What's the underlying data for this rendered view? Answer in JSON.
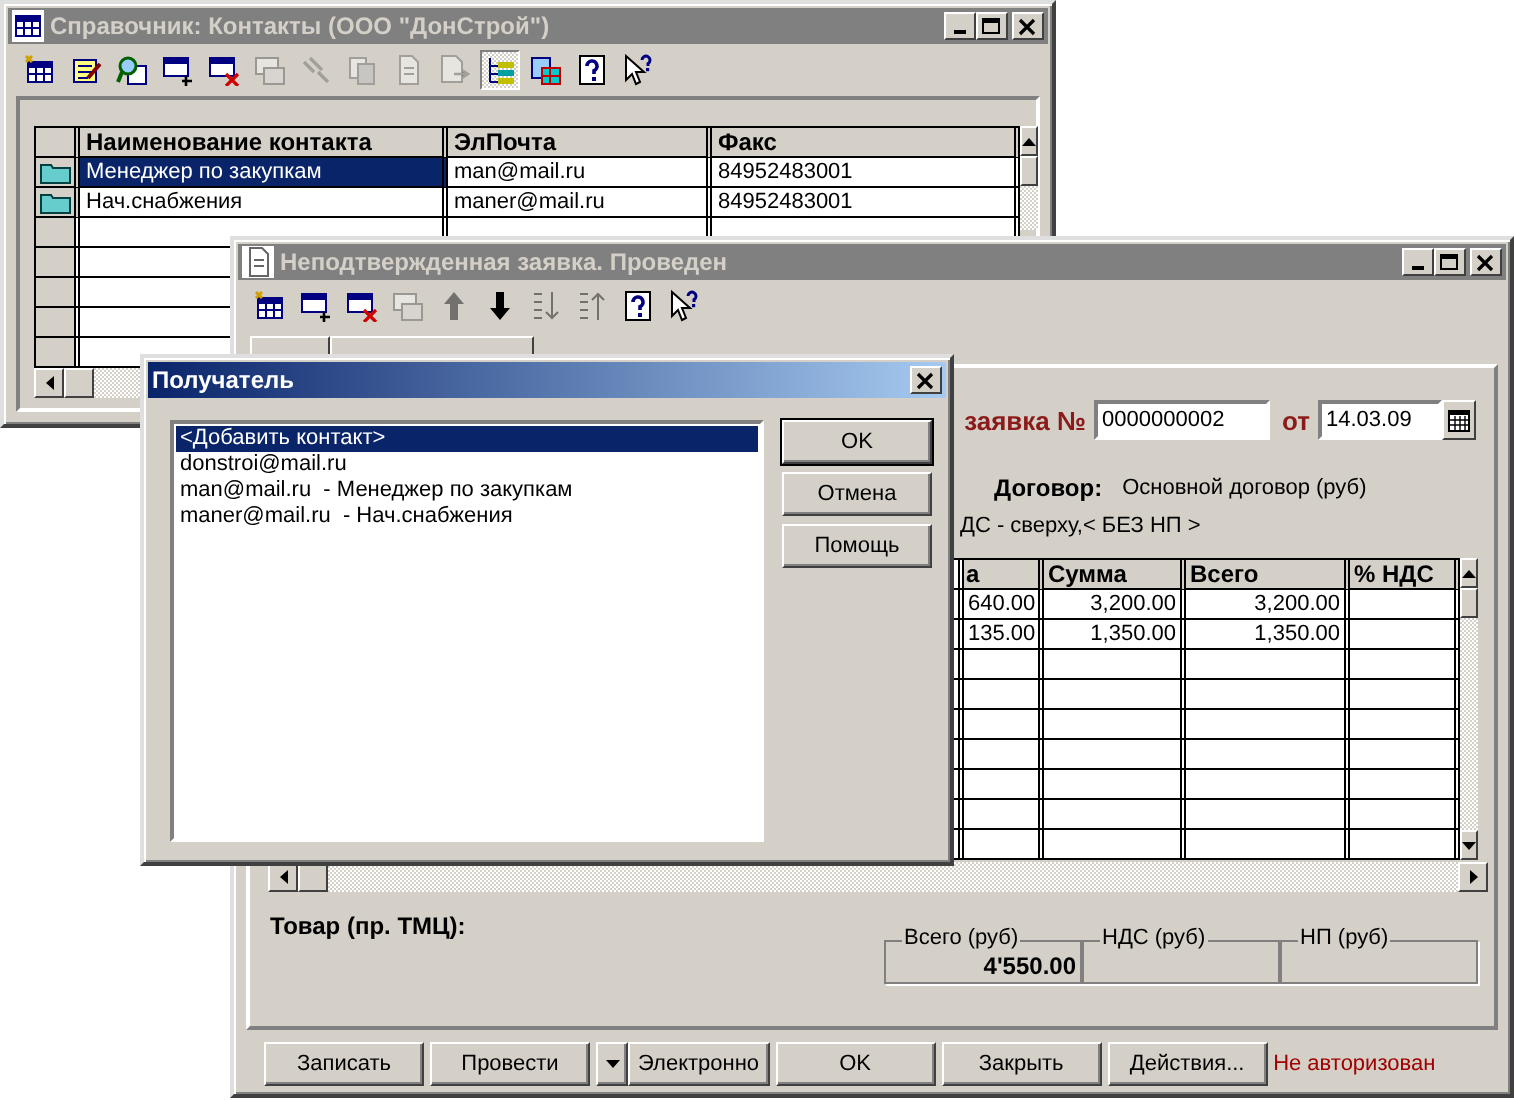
{
  "contacts_window": {
    "title": "Справочник: Контакты (ООО \"ДонСтрой\")",
    "active": false,
    "toolbar": [
      {
        "disabled": false,
        "pressed": false
      },
      {
        "disabled": false,
        "pressed": false
      },
      {
        "disabled": false,
        "pressed": false
      },
      {
        "disabled": false,
        "pressed": false
      },
      {
        "disabled": false,
        "pressed": false
      },
      {
        "disabled": true,
        "pressed": false
      },
      {
        "disabled": true,
        "pressed": false
      },
      {
        "disabled": true,
        "pressed": false
      },
      {
        "disabled": true,
        "pressed": false
      },
      {
        "disabled": true,
        "pressed": false
      },
      {
        "disabled": false,
        "pressed": true
      },
      {
        "disabled": false,
        "pressed": false
      },
      {
        "disabled": false,
        "pressed": false
      },
      {
        "disabled": false,
        "pressed": false
      }
    ],
    "columns": [
      "Наименование контакта",
      "ЭлПочта",
      "Факс"
    ],
    "rows": [
      {
        "selected": true,
        "cells": [
          "Менеджер по закупкам",
          "man@mail.ru",
          "84952483001"
        ]
      },
      {
        "selected": false,
        "cells": [
          "Нач.снабжения",
          "maner@mail.ru",
          "84952483001"
        ]
      }
    ]
  },
  "document_window": {
    "title": "Неподтвержденная заявка. Проведен",
    "active": false,
    "toolbar": [
      {
        "disabled": false,
        "pressed": false
      },
      {
        "disabled": false,
        "pressed": false
      },
      {
        "disabled": false,
        "pressed": false
      },
      {
        "disabled": true,
        "pressed": false
      },
      {
        "disabled": true,
        "pressed": false
      },
      {
        "disabled": false,
        "pressed": false
      },
      {
        "disabled": true,
        "pressed": false
      },
      {
        "disabled": true,
        "pressed": false
      },
      {
        "disabled": false,
        "pressed": false
      },
      {
        "disabled": false,
        "pressed": false
      }
    ],
    "number_label": "заявка №",
    "number": "0000000002",
    "date_label": "от",
    "date": "14.03.09",
    "contract_label": "Договор:",
    "contract": "Основной договор (руб)",
    "tax_note": "ДС - сверху,< БЕЗ НП >",
    "columns": [
      "а",
      "Сумма",
      "Всего",
      "% НДС"
    ],
    "rows": [
      [
        "640.00",
        "3,200.00",
        "3,200.00"
      ],
      [
        "135.00",
        "1,350.00",
        "1,350.00"
      ]
    ],
    "goods_label": "Товар (пр. ТМЦ):",
    "totals": [
      {
        "label": "Всего (руб)",
        "value": "4'550.00"
      },
      {
        "label": "НДС (руб)"
      },
      {
        "label": "НП (руб)"
      }
    ],
    "buttons": [
      {
        "kind": "button",
        "label": "Записать"
      },
      {
        "kind": "button",
        "label": "Провести"
      },
      {
        "kind": "dropdown"
      },
      {
        "kind": "button",
        "label": "Электронно"
      },
      {
        "kind": "button",
        "label": "OK"
      },
      {
        "kind": "button",
        "label": "Закрыть"
      },
      {
        "kind": "button",
        "label": "Действия..."
      }
    ],
    "status": "Не авторизован"
  },
  "recipient_dialog": {
    "title": "Получатель",
    "active": true,
    "items": [
      {
        "label": "<Добавить контакт>",
        "selected": true
      },
      {
        "label": "donstroi@mail.ru",
        "selected": false
      },
      {
        "label": "man@mail.ru  - Менеджер по закупкам",
        "selected": false
      },
      {
        "label": "maner@mail.ru  - Нач.снабжения",
        "selected": false
      }
    ],
    "buttons": [
      {
        "label": "OK",
        "default": true
      },
      {
        "label": "Отмена",
        "default": false
      },
      {
        "label": "Помощь",
        "default": false
      }
    ]
  }
}
